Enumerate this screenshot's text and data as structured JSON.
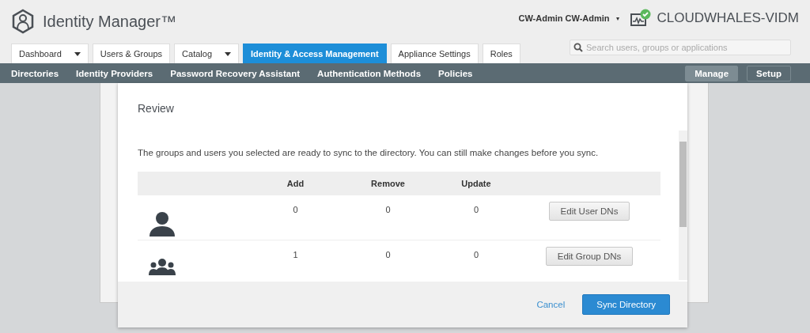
{
  "header": {
    "product": "Identity Manager™",
    "user_menu": "CW-Admin CW-Admin",
    "user_caret": "▾",
    "tenant": "CLOUDWHALES-VIDM",
    "search": {
      "placeholder": "Search users, groups or applications"
    }
  },
  "tabs": [
    {
      "label": "Dashboard",
      "dropdown": true,
      "selected": false
    },
    {
      "label": "Users & Groups",
      "dropdown": false,
      "selected": false
    },
    {
      "label": "Catalog",
      "dropdown": true,
      "selected": false
    },
    {
      "label": "Identity & Access Management",
      "dropdown": false,
      "selected": true
    },
    {
      "label": "Appliance Settings",
      "dropdown": false,
      "selected": false
    },
    {
      "label": "Roles",
      "dropdown": false,
      "selected": false
    }
  ],
  "subnav": {
    "items": [
      "Directories",
      "Identity Providers",
      "Password Recovery Assistant",
      "Authentication Methods",
      "Policies"
    ],
    "modes": [
      {
        "label": "Manage",
        "selected": true
      },
      {
        "label": "Setup",
        "selected": false
      }
    ]
  },
  "dialog": {
    "title": "Review",
    "message": "The groups and users you selected are ready to sync to the directory. You can still make changes before you sync.",
    "columns": [
      "Add",
      "Remove",
      "Update"
    ],
    "rows": [
      {
        "kind": "user",
        "add": "0",
        "remove": "0",
        "update": "0",
        "action": "Edit User DNs"
      },
      {
        "kind": "group",
        "add": "1",
        "remove": "0",
        "update": "0",
        "action": "Edit Group DNs"
      }
    ],
    "cancel": "Cancel",
    "confirm": "Sync Directory"
  }
}
